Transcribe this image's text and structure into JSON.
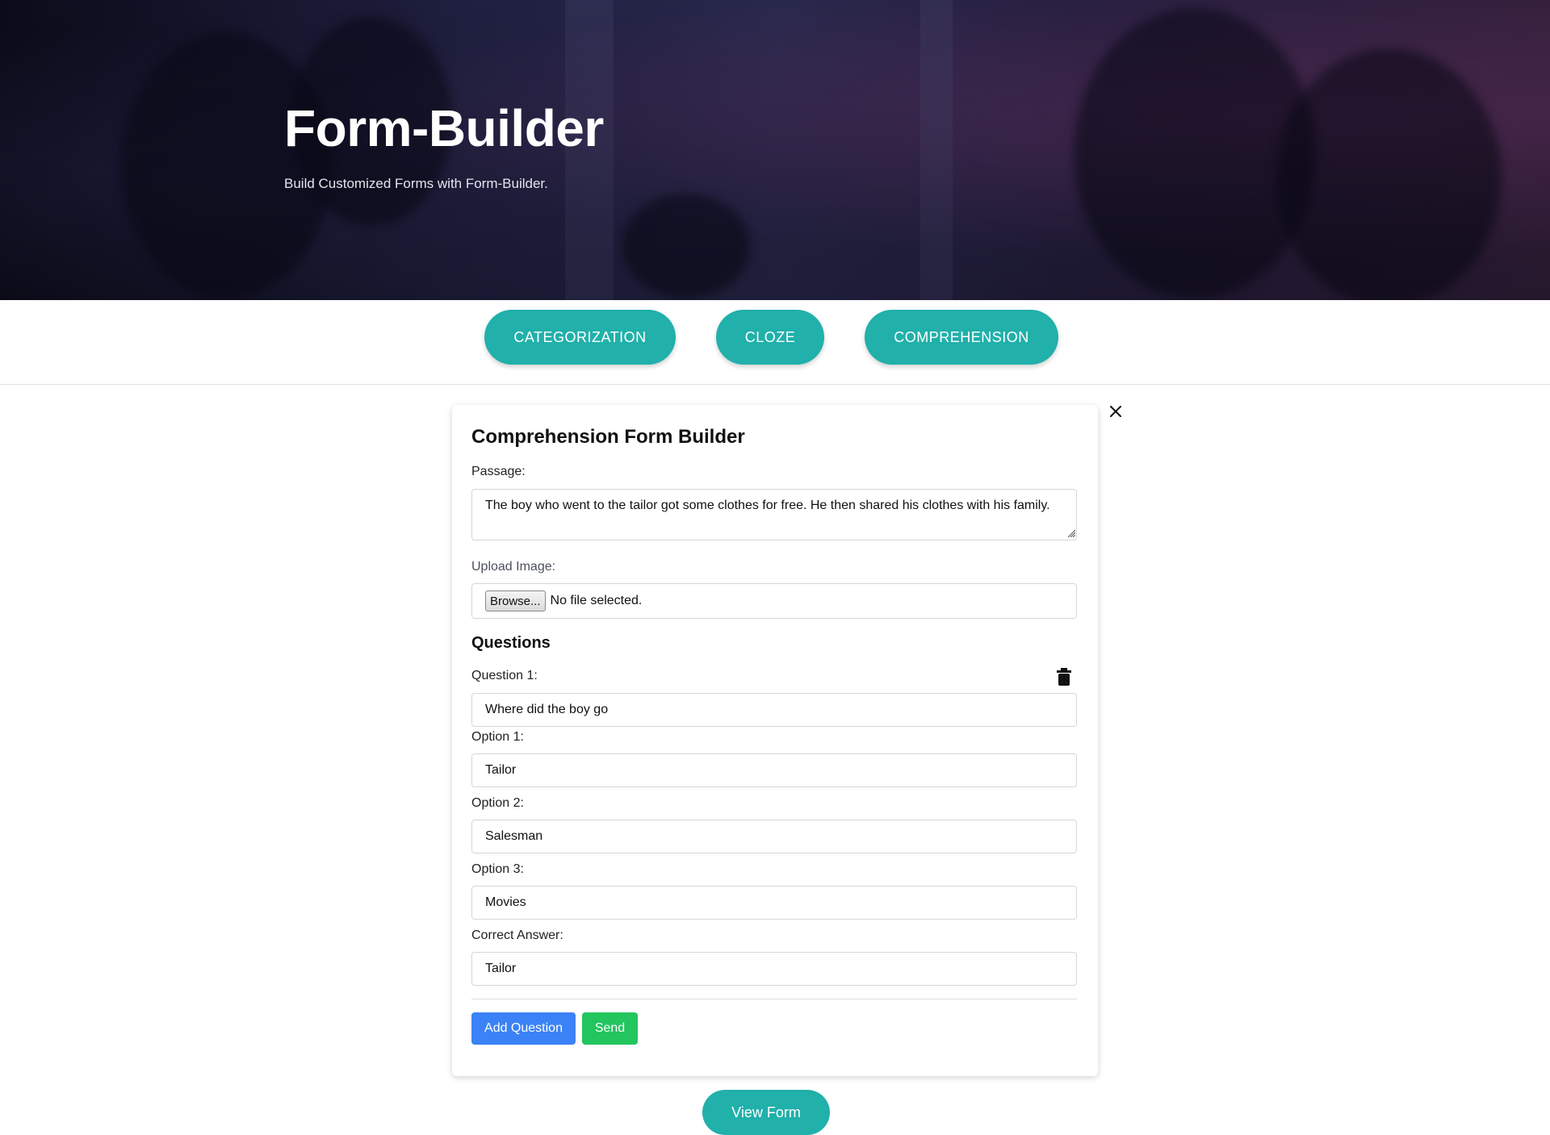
{
  "hero": {
    "title": "Form-Builder",
    "subtitle": "Build Customized Forms with Form-Builder."
  },
  "nav": {
    "buttons": [
      {
        "label": "CATEGORIZATION"
      },
      {
        "label": "CLOZE"
      },
      {
        "label": "COMPREHENSION"
      }
    ]
  },
  "builder": {
    "title": "Comprehension Form Builder",
    "passage_label": "Passage:",
    "passage_value": "The boy who went to the tailor got some clothes for free. He then shared his clothes with his family.",
    "upload_label": "Upload Image:",
    "browse_label": "Browse...",
    "file_status": "No file selected.",
    "questions_heading": "Questions",
    "question": {
      "label": "Question 1:",
      "value": "Where did the boy go",
      "options": [
        {
          "label": "Option 1:",
          "value": "Tailor"
        },
        {
          "label": "Option 2:",
          "value": "Salesman"
        },
        {
          "label": "Option 3:",
          "value": "Movies"
        }
      ],
      "correct_label": "Correct Answer:",
      "correct_value": "Tailor"
    },
    "add_question_label": "Add Question",
    "send_label": "Send"
  },
  "view_form_label": "View Form",
  "colors": {
    "accent_teal": "#21b0aa",
    "primary_blue": "#3b82f6",
    "success_green": "#22c55e"
  },
  "icons": {
    "close": "close-icon",
    "delete": "trash-icon"
  }
}
